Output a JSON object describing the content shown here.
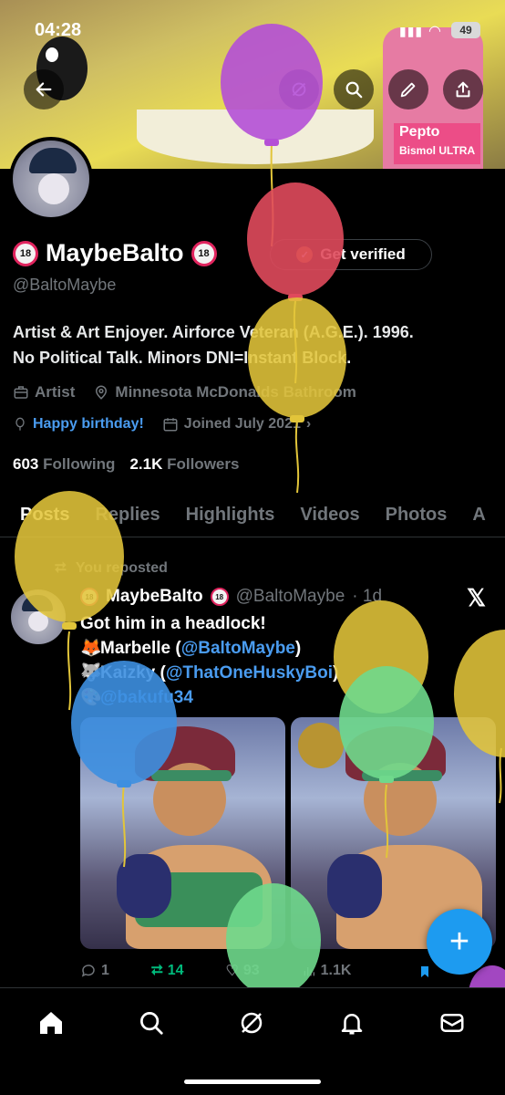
{
  "status": {
    "time": "04:28",
    "signal": "▮▮▮",
    "wifi": "◠",
    "battery": "49"
  },
  "banner": {
    "pepto_line1": "Pepto",
    "pepto_line2": "Bismol ULTRA"
  },
  "profile": {
    "name": "MaybeBalto",
    "badge_emoji": "18",
    "verify_label": "Get verified",
    "handle": "@BaltoMaybe",
    "bio_line1": "Artist & Art Enjoyer. Airforce Veteran (A.G.E.). 1996.",
    "bio_line2": "No Political Talk. Minors DNI=Instant Block.",
    "category": "Artist",
    "location": "Minnesota McDonalds Bathroom",
    "birthday": "Happy birthday!",
    "joined": "Joined July 2021",
    "following_count": "603",
    "following_label": "Following",
    "followers_count": "2.1K",
    "followers_label": "Followers"
  },
  "tabs": [
    "Posts",
    "Replies",
    "Highlights",
    "Videos",
    "Photos",
    "A"
  ],
  "post": {
    "repost_label": "You reposted",
    "name": "MaybeBalto",
    "handle": "@BaltoMaybe",
    "time": "· 1d",
    "line1": "Got him in a headlock!",
    "line2_name": "Marbelle (",
    "line2_mention": "@BaltoMaybe",
    "line2_end": ")",
    "line3_name": "Kaizky (",
    "line3_mention": "@ThatOneHuskyBoi",
    "line3_end": ")",
    "line4_mention": "@bakufu34",
    "replies": "1",
    "reposts": "14",
    "likes": "93",
    "views": "1.1K"
  },
  "colors": {
    "accent": "#1d9bf0",
    "balloon_purple": "#b44fd6",
    "balloon_red": "#e04a5c",
    "balloon_yellow": "#e2c53a",
    "balloon_blue": "#3d8fe0",
    "balloon_green": "#6fd98c"
  }
}
